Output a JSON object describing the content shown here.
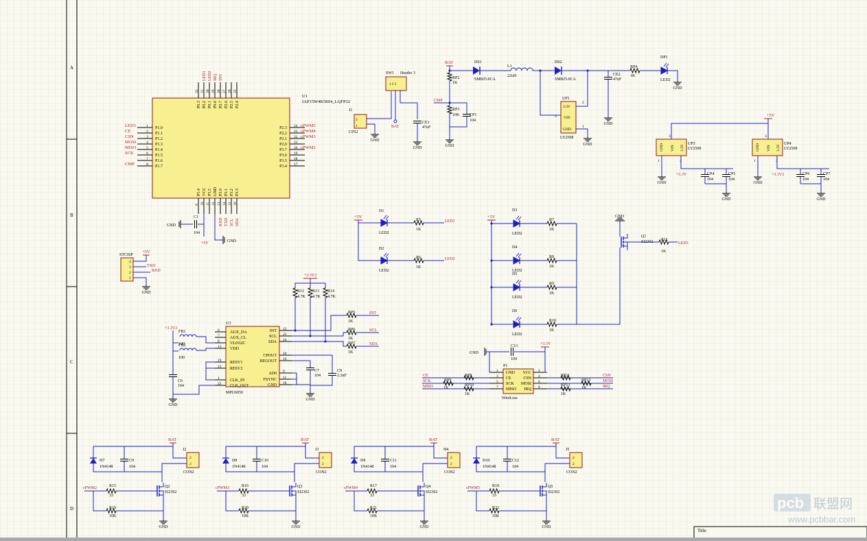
{
  "sheet": {
    "zone_rows": [
      "A",
      "B",
      "C",
      "D"
    ],
    "title_label": "Title",
    "watermark_brand": "pcb",
    "watermark_cn": "联盟网",
    "watermark_url": "www.pcbbar.com",
    "grid_color": "#dcdcdc",
    "wire_color": "#1f1fbf",
    "net_label_color": "#b02020",
    "body_color": "#f7ef90",
    "sheet_color": "#f9f9f0"
  },
  "mcu": {
    "designator": "U1",
    "part": "IAP15W4K58S4_LQFP32",
    "left_pins": [
      {
        "net": "LED3",
        "name": "P1.0",
        "num": "1"
      },
      {
        "net": "CE",
        "name": "P1.1",
        "num": "2"
      },
      {
        "net": "CSN",
        "name": "P1.2",
        "num": "3"
      },
      {
        "net": "MOSI",
        "name": "P1.3",
        "num": "4"
      },
      {
        "net": "MISO",
        "name": "P1.4",
        "num": "5"
      },
      {
        "net": "SCK",
        "name": "P1.5",
        "num": "6"
      },
      {
        "net": "",
        "name": "P1.6",
        "num": "7"
      },
      {
        "net": "CMP",
        "name": "P1.7",
        "num": "8"
      }
    ],
    "right_pins": [
      {
        "net": "cPWM5",
        "name": "P2.3",
        "num": "24"
      },
      {
        "net": "cPWM4",
        "name": "P2.2",
        "num": "23"
      },
      {
        "net": "cPWM3",
        "name": "P2.1",
        "num": "22"
      },
      {
        "net": "",
        "name": "P2.0",
        "num": "21"
      },
      {
        "net": "cPWM2",
        "name": "P3.7",
        "num": "20"
      },
      {
        "net": "",
        "name": "P3.6",
        "num": "19"
      },
      {
        "net": "",
        "name": "P3.5",
        "num": "18"
      },
      {
        "net": "",
        "name": "P3.4",
        "num": "17"
      }
    ],
    "top_pins": [
      {
        "name": "P0.3",
        "num": "32",
        "net": ""
      },
      {
        "name": "P0.2",
        "num": "31",
        "net": "LED1"
      },
      {
        "name": "P0.1",
        "num": "30",
        "net": "LED2"
      },
      {
        "name": "P0.0",
        "num": "29",
        "net": "IRQ"
      },
      {
        "name": "P2.7",
        "num": "28",
        "net": "INT"
      },
      {
        "name": "P2.6",
        "num": "27",
        "net": ""
      },
      {
        "name": "P2.5",
        "num": "26",
        "net": ""
      },
      {
        "name": "P2.4",
        "num": "25",
        "net": ""
      }
    ],
    "bottom_pins": [
      {
        "name": "P5.4",
        "num": "9",
        "net": ""
      },
      {
        "name": "VCC",
        "num": "10",
        "net": ""
      },
      {
        "name": "P5.5",
        "num": "11",
        "net": ""
      },
      {
        "name": "GND",
        "num": "12",
        "net": ""
      },
      {
        "name": "P3.0",
        "num": "13",
        "net": "RXD"
      },
      {
        "name": "P3.1",
        "num": "14",
        "net": "TXD"
      },
      {
        "name": "P3.2",
        "num": "15",
        "net": "SCL"
      },
      {
        "name": "P3.3",
        "num": "16",
        "net": "SDA"
      }
    ],
    "c1": {
      "ref": "C1",
      "val": "104"
    },
    "gnd": "GND",
    "vcc": "+5V"
  },
  "power_in": {
    "j1": {
      "ref": "J1",
      "label": "CIN2",
      "pins": [
        "2",
        "1"
      ]
    },
    "sw1": {
      "ref": "SW1",
      "part": "Header 3",
      "pins": "1 2 3"
    },
    "bat": "BAT",
    "ce1": {
      "ref": "CE1",
      "val": "47uF"
    },
    "gnd": "GND"
  },
  "regulator": {
    "bat": "BAT",
    "rp2": {
      "ref": "RP2",
      "val": "1K"
    },
    "rp3": {
      "ref": "RP3",
      "val": "10K"
    },
    "cp1": {
      "ref": "CP1",
      "val": "104"
    },
    "cmp": "CMP",
    "ds1": {
      "ref": "DS1",
      "val": "SMBJ5.0CA"
    },
    "l1": {
      "ref": "L1",
      "val": "22uH"
    },
    "ds2": {
      "ref": "DS2",
      "val": "SMBJ5.0CA"
    },
    "up1": {
      "ref": "UP1",
      "part": "LY2508",
      "p1": "3.3V",
      "p2": "VIN",
      "p3": "GND",
      "n2": "2",
      "n3": "3",
      "n1": "1"
    },
    "ce2": {
      "ref": "CE2",
      "val": "47uF"
    },
    "rp4": {
      "ref": "RP4",
      "val": "1K"
    },
    "dp1": {
      "ref": "DP1",
      "val": "LED2"
    },
    "gnd": "GND"
  },
  "ldo3": {
    "up3": {
      "ref": "UP3",
      "part": "LY2508",
      "p_gnd": "GND",
      "p_vin": "VIN",
      "p_out": "3.3V",
      "n3": "3",
      "n1": "1",
      "n2": "2"
    },
    "up4": {
      "ref": "UP4",
      "part": "LY2508",
      "p_gnd": "GND",
      "p_vin": "VIN",
      "p_out": "3.3V",
      "n3": "3",
      "n1": "1",
      "n2": "2"
    },
    "cp4": {
      "ref": "CP4",
      "val": "104"
    },
    "cp5": {
      "ref": "CP5",
      "val": "104"
    },
    "cp6": {
      "ref": "CP6",
      "val": "104"
    },
    "cp7": {
      "ref": "CP7",
      "val": "104"
    },
    "v33": "+3.3V",
    "v33b": "+3.3V2",
    "v5": "+5V",
    "gnd": "GND"
  },
  "isp": {
    "ref": "STCISP",
    "pins": [
      "4",
      "3",
      "2",
      "1"
    ],
    "v5": "+5V",
    "txd": "TXD",
    "rxd": "RXD",
    "gnd": "GND"
  },
  "leds_left": {
    "v5": "+5V",
    "d1": {
      "ref": "D1",
      "val": "LED2",
      "r": "R5",
      "rv": "1K",
      "net": "LED1"
    },
    "d2": {
      "ref": "D2",
      "val": "LED2",
      "r": "R6",
      "rv": "1K",
      "net": "LED2"
    }
  },
  "leds_right": {
    "v5": "+5V",
    "rows": [
      {
        "ref": "D3",
        "val": "LED2",
        "r": "R7",
        "rv": "1K"
      },
      {
        "ref": "D4",
        "val": "LED2",
        "r": "R8",
        "rv": "1K"
      },
      {
        "ref": "D5",
        "val": "LED2",
        "r": "R9",
        "rv": "1K"
      },
      {
        "ref": "D6",
        "val": "LED2",
        "r": "R10",
        "rv": "1K"
      }
    ],
    "q1": {
      "ref": "Q1",
      "part": "SI2302"
    },
    "r11": {
      "ref": "R11",
      "val": "1K"
    },
    "net": "LED3",
    "gnd": "GND"
  },
  "imu": {
    "ref": "U3",
    "part": "MPU6050",
    "left_pins": [
      {
        "num": "6",
        "name": "AUX_DA"
      },
      {
        "num": "7",
        "name": "AUX_CL"
      },
      {
        "num": "8",
        "name": "VLOGIC"
      },
      {
        "num": "13",
        "name": "VDD"
      },
      {
        "num": "19",
        "name": "RESV1"
      },
      {
        "num": "21",
        "name": "RESV2"
      },
      {
        "num": "1",
        "name": "CLK_IN"
      },
      {
        "num": "22",
        "name": "CLK_OUT"
      }
    ],
    "right_pins": [
      {
        "num": "12",
        "name": "INT"
      },
      {
        "num": "23",
        "name": "SCL"
      },
      {
        "num": "24",
        "name": "SDA"
      },
      {
        "num": "20",
        "name": "CPOUT"
      },
      {
        "num": "10",
        "name": "REGOUT"
      },
      {
        "num": "9",
        "name": "AD0"
      },
      {
        "num": "11",
        "name": "FSYNC"
      },
      {
        "num": "18",
        "name": "GND"
      }
    ],
    "v33": "+3.3V2",
    "v33b": "+3.3V2",
    "fb1": {
      "ref": "FB1",
      "val": "100"
    },
    "fb2": {
      "ref": "FB2",
      "val": "100"
    },
    "c6": {
      "ref": "C6",
      "val": "104"
    },
    "c7": {
      "ref": "C7",
      "val": "104"
    },
    "c8": {
      "ref": "C8",
      "val": "2.2nF"
    },
    "r12": {
      "ref": "R12",
      "val": "4.7K"
    },
    "r13": {
      "ref": "R13",
      "val": "4.7K"
    },
    "r14": {
      "ref": "R14",
      "val": "4.7K"
    },
    "rp5": {
      "ref": "RP5",
      "val": "1K",
      "net": "INT"
    },
    "rp6": {
      "ref": "RP6",
      "val": "1K",
      "net": "SCL"
    },
    "rp7": {
      "ref": "RP7",
      "val": "1K",
      "net": "SDA"
    },
    "gnd": "GND"
  },
  "radio": {
    "ref": "P1",
    "part": "WireLess",
    "gnd": "GND",
    "v33": "+3.3V",
    "c13": {
      "ref": "C13",
      "val": "104"
    },
    "left_pins": [
      {
        "num": "1",
        "name": "GND"
      },
      {
        "num": "3",
        "name": "CE"
      },
      {
        "num": "5",
        "name": "SCK"
      },
      {
        "num": "7",
        "name": "MISO"
      }
    ],
    "right_pins": [
      {
        "num": "2",
        "name": "VCC"
      },
      {
        "num": "4",
        "name": "CSN"
      },
      {
        "num": "6",
        "name": "MOSI"
      },
      {
        "num": "8",
        "name": "IRQ"
      }
    ],
    "left_nets": [
      "CE",
      "SCK",
      "MISO"
    ],
    "right_nets": [
      "CSN",
      "MOSI",
      "IRQ"
    ],
    "rp8": {
      "ref": "RP8",
      "val": "1K"
    },
    "rp9": {
      "ref": "RP9",
      "val": "1K"
    },
    "rp10": {
      "ref": "RP10",
      "val": "1K"
    },
    "rp11": {
      "ref": "RP11",
      "val": "1K"
    },
    "rp12": {
      "ref": "RP12",
      "val": "1K"
    },
    "rp13": {
      "ref": "RP13",
      "val": "1K"
    }
  },
  "motors": [
    {
      "diode": "D7",
      "dval": "1N4148",
      "cap": "C9",
      "cval": "104",
      "conn": "J2",
      "clabel": "CON2",
      "q": "Q2",
      "qpart": "SI2302",
      "rg": "R15",
      "rgval": "33",
      "rd": "R19",
      "rdval": "10K",
      "net": "cPWM2",
      "bat": "BAT",
      "gnd": "GND"
    },
    {
      "diode": "D8",
      "dval": "1N4148",
      "cap": "C10",
      "cval": "104",
      "conn": "J3",
      "clabel": "CON2",
      "q": "Q3",
      "qpart": "SI2302",
      "rg": "R16",
      "rgval": "33",
      "rd": "R20",
      "rdval": "10K",
      "net": "cPWM3",
      "bat": "BAT",
      "gnd": "GND"
    },
    {
      "diode": "D9",
      "dval": "1N4148",
      "cap": "C11",
      "cval": "104",
      "conn": "H4",
      "clabel": "CON2",
      "q": "Q4",
      "qpart": "SI2302",
      "rg": "R17",
      "rgval": "33",
      "rd": "R21",
      "rdval": "10K",
      "net": "cPWM4",
      "bat": "BAT",
      "gnd": "GND"
    },
    {
      "diode": "D10",
      "dval": "1N4148",
      "cap": "C12",
      "cval": "104",
      "conn": "J5",
      "clabel": "CON2",
      "q": "Q5",
      "qpart": "SI2302",
      "rg": "R18",
      "rgval": "33",
      "rd": "R22",
      "rdval": "10K",
      "net": "cPWM5",
      "bat": "BAT",
      "gnd": "GND"
    }
  ]
}
